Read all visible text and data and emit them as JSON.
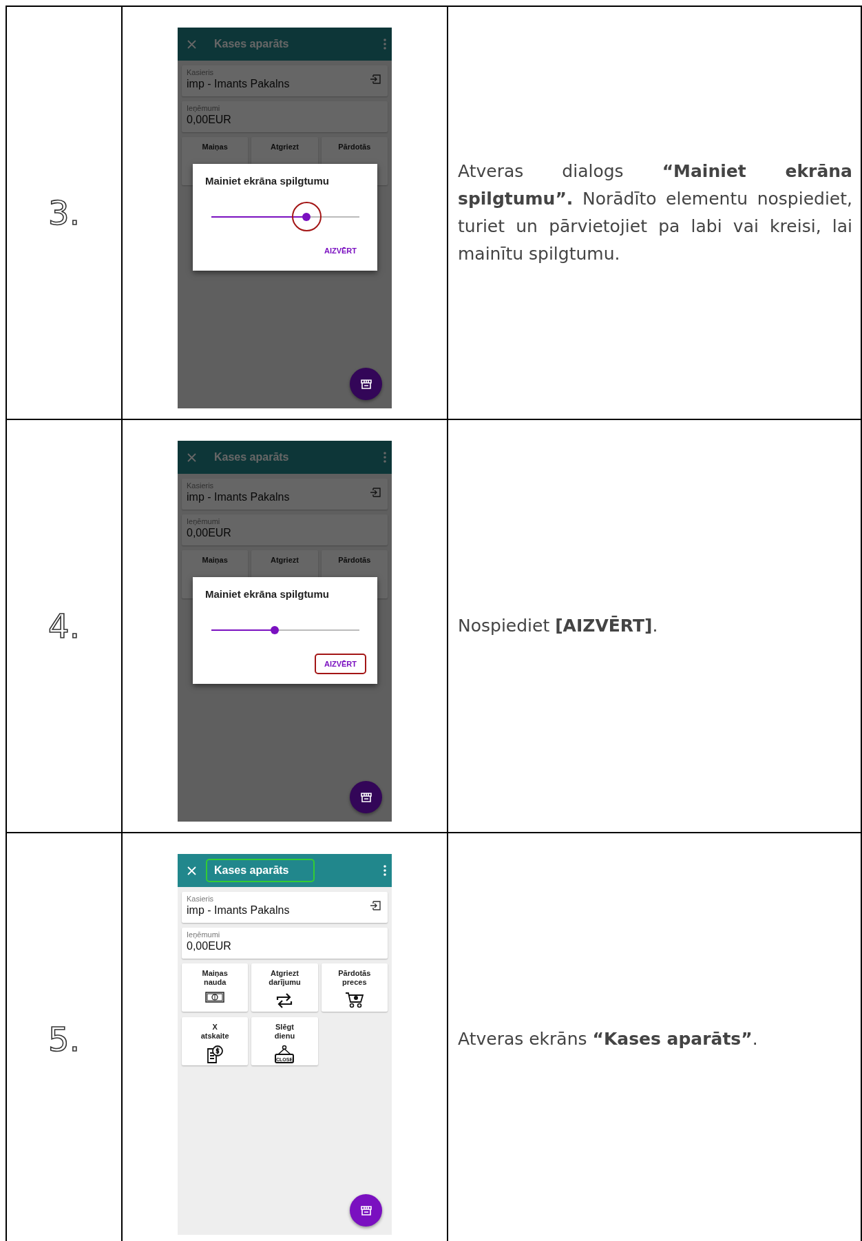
{
  "rows": [
    {
      "number": "3.",
      "screen": {
        "dimmed": true,
        "title": "Kases aparāts",
        "cashier_label": "Kasieris",
        "cashier_value": "imp - Imants Pakalns",
        "revenue_label": "Ieņēmumi",
        "revenue_value": "0,00EUR",
        "tiles": [
          {
            "lines": [
              "Maiņas"
            ]
          },
          {
            "lines": [
              "Atgriezt"
            ]
          },
          {
            "lines": [
              "Pārdotās"
            ]
          }
        ],
        "dialog": {
          "title": "Mainiet ekrāna spilgtumu",
          "level": 0.64,
          "button": "AIZVĒRT"
        },
        "highlight": {
          "kind": "slider",
          "color": "#a31515"
        }
      },
      "description": "Atveras dialogs **“Mainiet ekrāna spilgtumu”.** Norādīto elementu nospiediet, turiet un pārvietojiet pa labi vai kreisi, lai mainītu spilgtumu."
    },
    {
      "number": "4.",
      "screen": {
        "dimmed": true,
        "title": "Kases aparāts",
        "cashier_label": "Kasieris",
        "cashier_value": "imp - Imants Pakalns",
        "revenue_label": "Ieņēmumi",
        "revenue_value": "0,00EUR",
        "tiles": [
          {
            "lines": [
              "Maiņas"
            ]
          },
          {
            "lines": [
              "Atgriezt"
            ]
          },
          {
            "lines": [
              "Pārdotās"
            ]
          }
        ],
        "dialog": {
          "title": "Mainiet ekrāna spilgtumu",
          "level": 0.43,
          "button": "AIZVĒRT"
        },
        "highlight": {
          "kind": "button",
          "color": "#a31515"
        }
      },
      "description": "Nospiediet **[AIZVĒRT]**."
    },
    {
      "number": "5.",
      "screen": {
        "dimmed": false,
        "title": "Kases aparāts",
        "cashier_label": "Kasieris",
        "cashier_value": "imp - Imants Pakalns",
        "revenue_label": "Ieņēmumi",
        "revenue_value": "0,00EUR",
        "tiles": [
          {
            "lines": [
              "Maiņas",
              "nauda"
            ],
            "kind": "cash"
          },
          {
            "lines": [
              "Atgriezt",
              "darījumu"
            ],
            "kind": "swap"
          },
          {
            "lines": [
              "Pārdotās",
              "preces"
            ],
            "kind": "cart"
          },
          {
            "lines": [
              "X",
              "atskaite"
            ],
            "kind": "report"
          },
          {
            "lines": [
              "Slēgt",
              "dienu"
            ],
            "kind": "sign",
            "icon_text": "CLOSE"
          }
        ],
        "highlight": {
          "kind": "title",
          "color": "#33cc33"
        }
      },
      "description": "Atveras ekrāns **“Kases aparāts”**."
    }
  ]
}
